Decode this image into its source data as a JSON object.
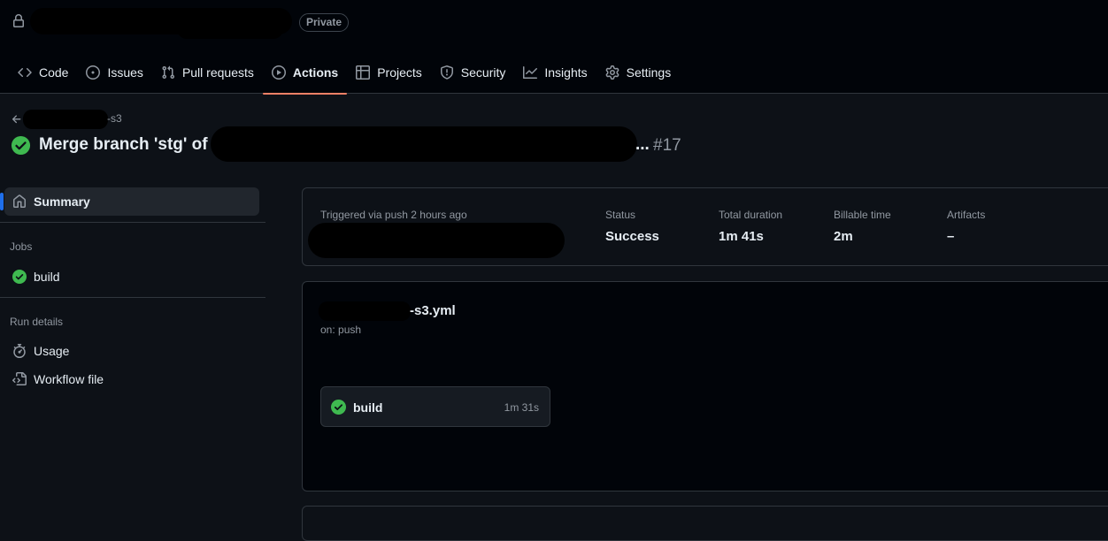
{
  "header": {
    "visibility_badge": "Private",
    "tabs": [
      {
        "label": "Code",
        "icon": "code-icon"
      },
      {
        "label": "Issues",
        "icon": "issue-opened-icon"
      },
      {
        "label": "Pull requests",
        "icon": "git-pull-request-icon"
      },
      {
        "label": "Actions",
        "icon": "play-icon",
        "active": true
      },
      {
        "label": "Projects",
        "icon": "table-icon"
      },
      {
        "label": "Security",
        "icon": "shield-icon"
      },
      {
        "label": "Insights",
        "icon": "graph-icon"
      },
      {
        "label": "Settings",
        "icon": "gear-icon"
      }
    ]
  },
  "breadcrumb": {
    "workflow_suffix": "-s3"
  },
  "run": {
    "title": "Merge branch 'stg' of",
    "title_ellipsis": "...",
    "number": "#17",
    "status_color": "#3fb950"
  },
  "sidebar": {
    "summary_label": "Summary",
    "jobs_heading": "Jobs",
    "jobs": [
      {
        "label": "build"
      }
    ],
    "run_details_heading": "Run details",
    "usage_label": "Usage",
    "workflow_file_label": "Workflow file"
  },
  "summary": {
    "triggered_text": "Triggered via push 2 hours ago",
    "status_label": "Status",
    "status_value": "Success",
    "duration_label": "Total duration",
    "duration_value": "1m 41s",
    "billable_label": "Billable time",
    "billable_value": "2m",
    "artifacts_label": "Artifacts",
    "artifacts_value": "–"
  },
  "workflow": {
    "file_suffix": "-s3.yml",
    "trigger": "on: push",
    "job": {
      "name": "build",
      "duration": "1m 31s"
    }
  }
}
